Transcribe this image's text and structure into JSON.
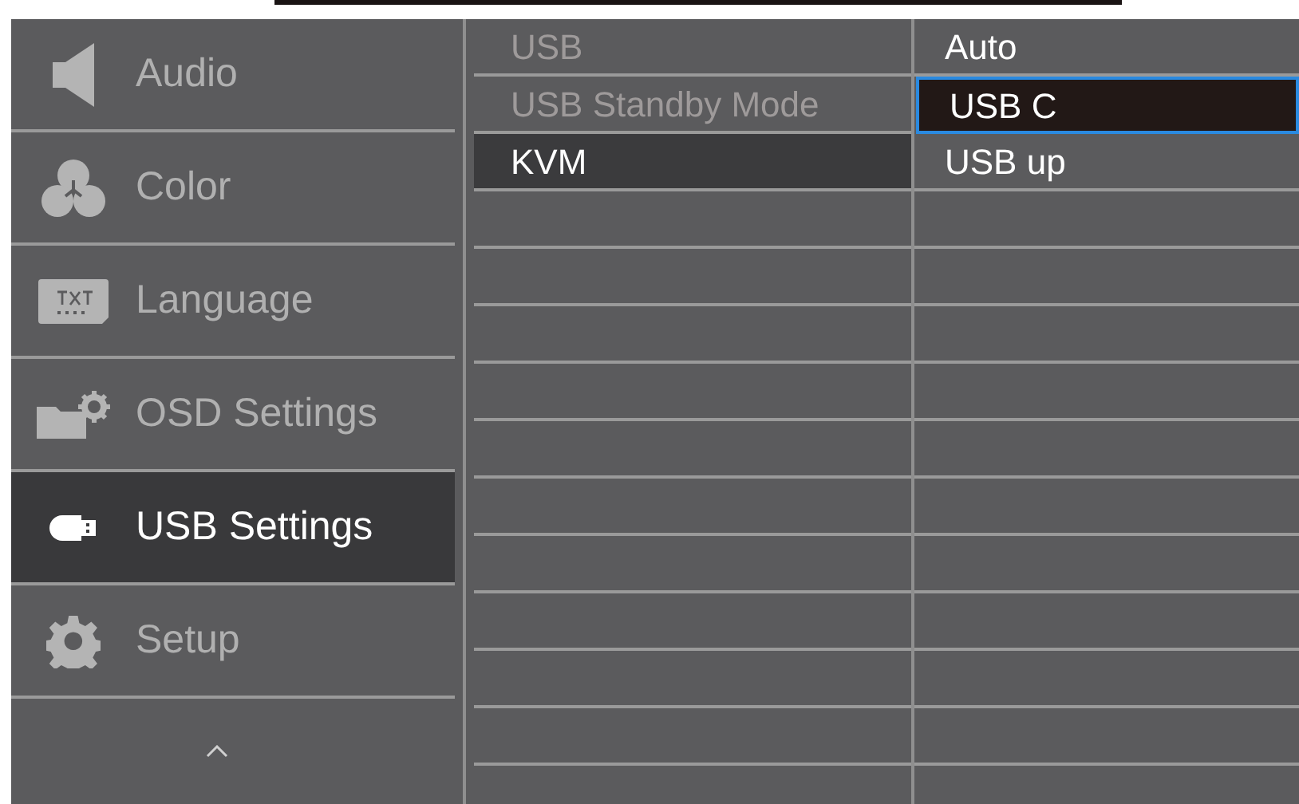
{
  "main_menu": [
    {
      "label": "Audio",
      "kind": "speaker",
      "selected": false
    },
    {
      "label": "Color",
      "kind": "color",
      "selected": false
    },
    {
      "label": "Language",
      "kind": "txt",
      "selected": false
    },
    {
      "label": "OSD Settings",
      "kind": "osd",
      "selected": false
    },
    {
      "label": "USB Settings",
      "kind": "usb",
      "selected": true
    },
    {
      "label": "Setup",
      "kind": "gear",
      "selected": false
    }
  ],
  "submenu": [
    {
      "label": "USB",
      "disabled": true,
      "selected": false
    },
    {
      "label": "USB Standby Mode",
      "disabled": true,
      "selected": false
    },
    {
      "label": "KVM",
      "disabled": false,
      "selected": true
    }
  ],
  "options": [
    {
      "label": "Auto",
      "selected": false
    },
    {
      "label": "USB C",
      "selected": true
    },
    {
      "label": "USB up",
      "selected": false
    }
  ]
}
